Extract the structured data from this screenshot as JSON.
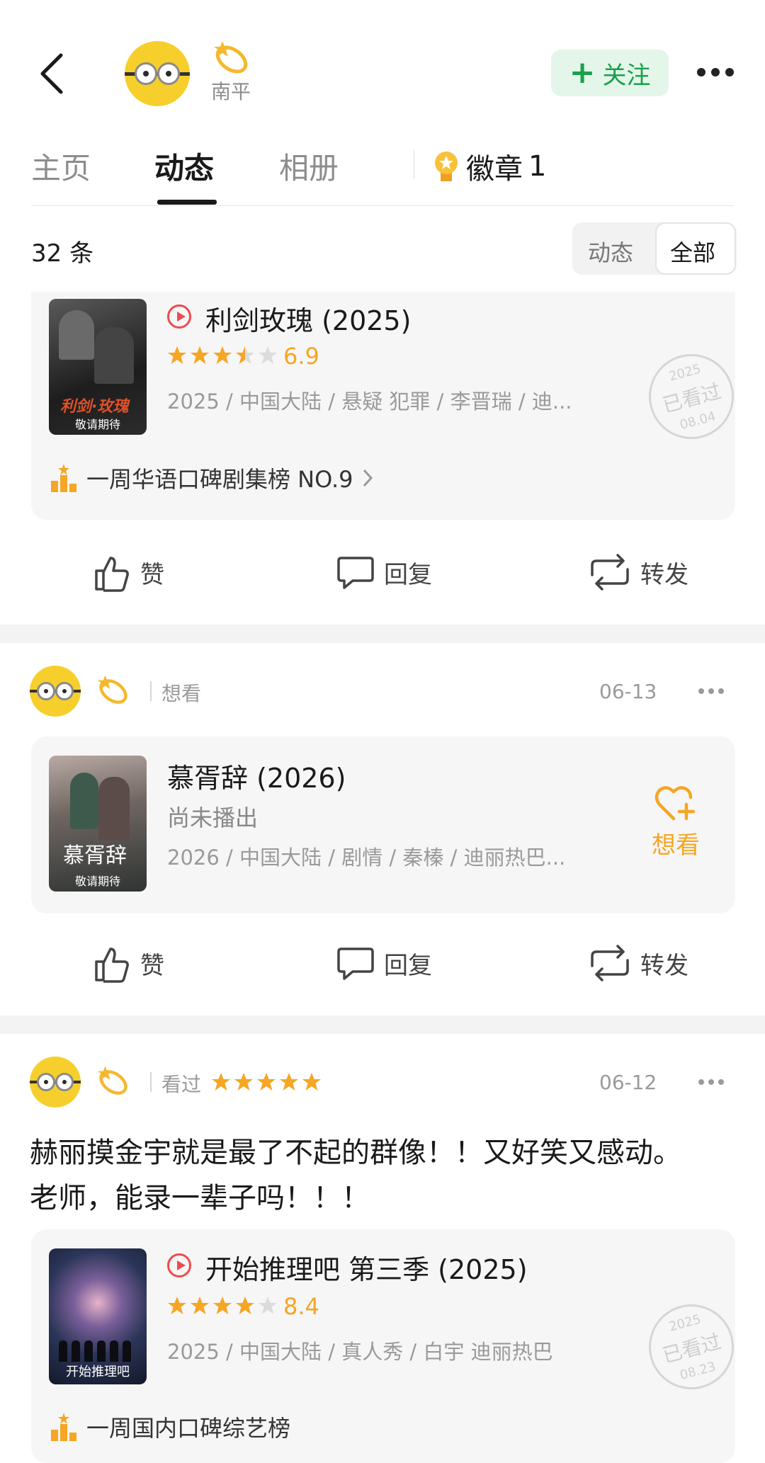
{
  "header": {
    "username": "南平",
    "follow_label": "关注",
    "follow_plus": "+"
  },
  "tabs": [
    {
      "label": "主页"
    },
    {
      "label": "动态"
    },
    {
      "label": "相册"
    }
  ],
  "badge": {
    "label": "徽章",
    "count": "1"
  },
  "filter": {
    "count_text": "32 条",
    "options": [
      "动态",
      "全部"
    ],
    "selected": "全部"
  },
  "actions": {
    "like": "赞",
    "reply": "回复",
    "repost": "转发"
  },
  "posts": [
    {
      "item": {
        "title": "利剑玫瑰 (2025)",
        "rating": "6.9",
        "stars": 3.5,
        "meta": "2025 / 中国大陆 / 悬疑 犯罪 / 李晋瑞 / 迪...",
        "poster_text": "利剑·玫瑰",
        "poster_sub": "敬请期待",
        "stamp_year": "2025",
        "stamp_label": "已看过",
        "stamp_date": "08.04",
        "rank": "一周华语口碑剧集榜 NO.9"
      }
    },
    {
      "status": "想看",
      "date": "06-13",
      "item": {
        "title": "慕胥辞 (2026)",
        "sub": "尚未播出",
        "meta": "2026 / 中国大陆 / 剧情 / 秦榛 / 迪丽热巴...",
        "poster_text": "慕胥辞",
        "poster_sub": "敬请期待",
        "wish_label": "想看"
      }
    },
    {
      "status": "看过",
      "stars": 5,
      "date": "06-12",
      "text_line1": "赫丽摸金宇就是最了不起的群像！！又好笑又感动。",
      "text_line2": "老师，能录一辈子吗！！！",
      "item": {
        "title": "开始推理吧 第三季 (2025)",
        "rating": "8.4",
        "stars": 4,
        "meta": "2025 / 中国大陆 / 真人秀 / 白宇 迪丽热巴",
        "poster_text": "开始推理吧",
        "stamp_year": "2025",
        "stamp_label": "已看过",
        "stamp_date": "08.23",
        "rank": "一周国内口碑综艺榜"
      }
    }
  ],
  "colors": {
    "accent_green": "#1aa14b",
    "star_orange": "#f5a623",
    "play_red": "#f04b4b",
    "avatar_yellow": "#f7cf2c"
  }
}
